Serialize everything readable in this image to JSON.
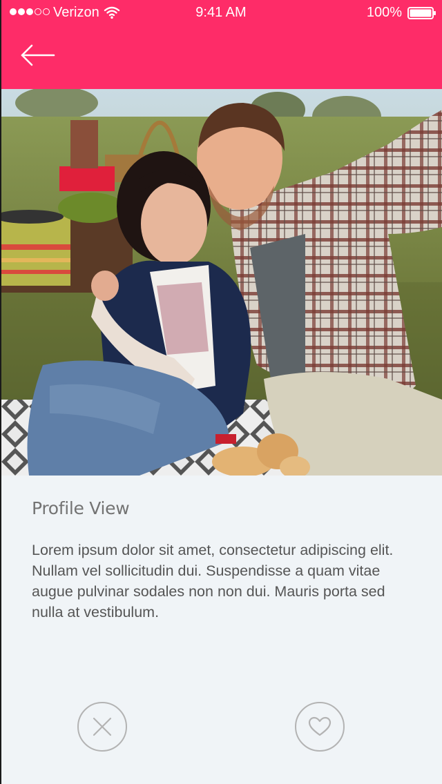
{
  "status_bar": {
    "carrier": "Verizon",
    "time": "9:41 AM",
    "battery": "100%",
    "signal_bars_filled": 3,
    "signal_bars_total": 5
  },
  "header": {
    "back_icon": "arrow-left-icon",
    "accent_color": "#fe2c68"
  },
  "photo": {
    "description_icon": "profile-photo"
  },
  "profile": {
    "title": "Profile View",
    "body": "Lorem ipsum dolor sit amet, consectetur adipiscing elit. Nullam vel sollicitudin dui. Suspendisse a quam vitae augue pulvinar sodales non non dui. Mauris porta sed nulla at vestibulum."
  },
  "actions": {
    "dislike_icon": "close-icon",
    "like_icon": "heart-icon"
  }
}
